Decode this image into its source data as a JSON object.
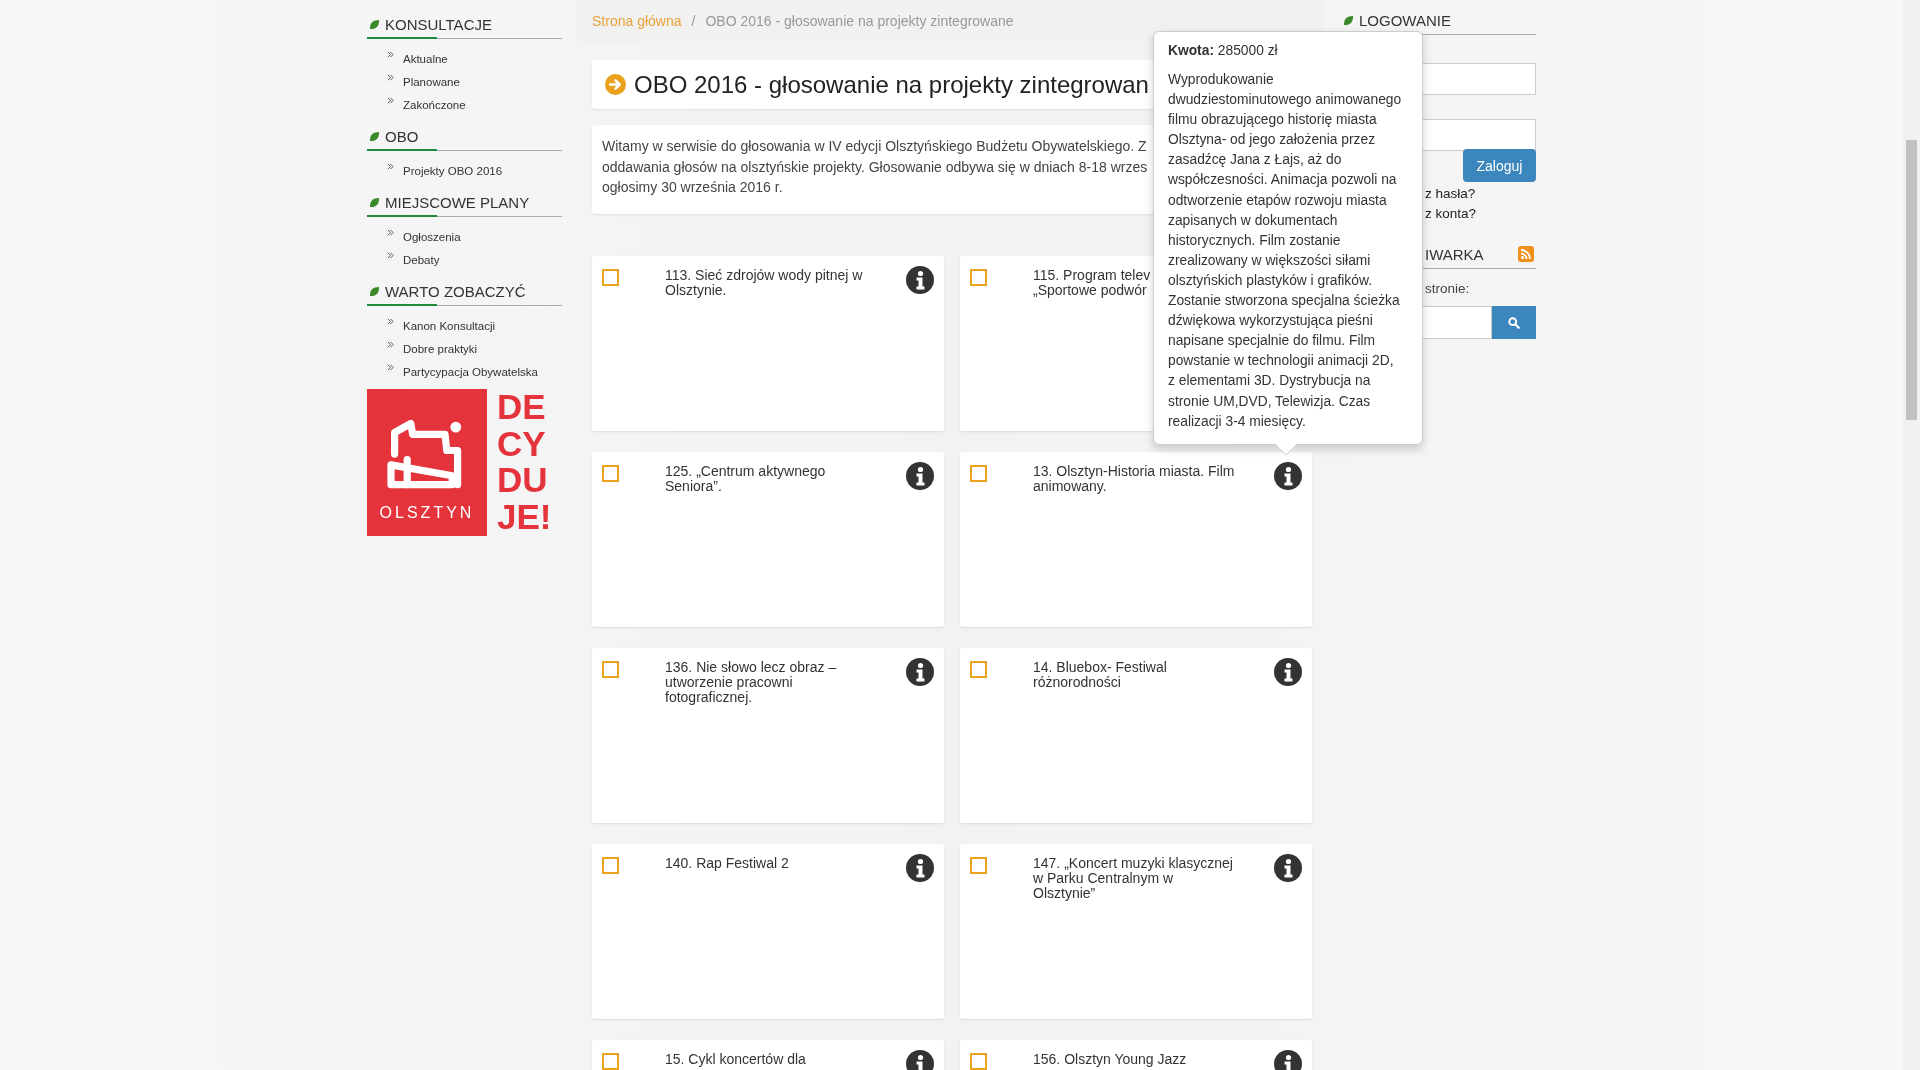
{
  "sidebar": {
    "sections": [
      {
        "title": "KONSULTACJE",
        "items": [
          "Aktualne",
          "Planowane",
          "Zakończone"
        ]
      },
      {
        "title": "OBO",
        "items": [
          "Projekty OBO 2016"
        ]
      },
      {
        "title": "MIEJSCOWE PLANY",
        "items": [
          "Ogłoszenia",
          "Debaty"
        ]
      },
      {
        "title": "WARTO ZOBACZYĆ",
        "items": [
          "Kanon Konsultacji",
          "Dobre praktyki",
          "Partycypacja Obywatelska"
        ]
      }
    ]
  },
  "logo": {
    "city": "OLSZTYN",
    "slogan": [
      "DE",
      "CY",
      "DU",
      "JE!"
    ]
  },
  "breadcrumb_separator": "/",
  "breadcrumb": [
    {
      "label": "Strona główna",
      "kind": "link"
    },
    {
      "label": "OBO 2016 - głosowanie na projekty zintegrowane",
      "kind": "current"
    }
  ],
  "page_title": "OBO 2016 - głosowanie na projekty zintegrowan",
  "intro_lines": [
    "Witamy w serwisie do głosowania w IV edycji Olsztyńskiego Budżetu Obywatelskiego. Z",
    "oddawania głosów na olsztyńskie projekty. Głosowanie odbywa się w dniach 8-18 wrzes",
    "ogłosimy 30 września 2016 r."
  ],
  "projects": [
    {
      "title": "113. Sieć zdrojów wody pitnej w Olsztynie.",
      "checked": false
    },
    {
      "title": "115. Program telev\n„Sportowe podwór",
      "checked": false,
      "info_visible": false
    },
    {
      "title": "125. „Centrum aktywnego Seniora”.",
      "checked": false
    },
    {
      "title": "13. Olsztyn-Historia miasta. Film animowany.",
      "checked": false
    },
    {
      "title": "136. Nie słowo lecz obraz – utworzenie pracowni fotograficznej.",
      "checked": false
    },
    {
      "title": "14. Bluebox- Festiwal różnorodności",
      "checked": false
    },
    {
      "title": "140. Rap Festiwal 2",
      "checked": false
    },
    {
      "title": "147. „Koncert muzyki klasycznej w Parku Centralnym w Olsztynie”",
      "checked": false
    },
    {
      "title": "15. Cykl koncertów dla",
      "checked": false
    },
    {
      "title": "156. Olsztyn Young Jazz",
      "checked": false
    }
  ],
  "tooltip": {
    "label": "Kwota:",
    "amount": "285000 zł",
    "description": "Wyprodukowanie dwudziestominutowego animowanego filmu obrazującego historię miasta Olsztyna- od jego założenia przez zasadźcę Jana z Łajs, aż do współczesności. Animacja pozwoli na odtworzenie etapów rozwoju miasta zapisanych w dokumentach historycznych. Film zostanie zrealizowany w większości siłami olsztyńskich plastyków i grafików. Zostanie stworzona specjalna ścieżka dźwiękowa wykorzystująca pieśni napisane specjalnie do filmu. Film powstanie w technologii animacji 2D, z elementami 3D. Dystrybucja na stronie UM,DVD, Telewizja. Czas realizacji 3-4 miesięcy."
  },
  "login": {
    "title": "LOGOWANIE",
    "button": "Zaloguj",
    "links": [
      "z hasła?",
      "z konta?"
    ]
  },
  "search": {
    "title": "IWARKA",
    "label": "stronie:"
  }
}
